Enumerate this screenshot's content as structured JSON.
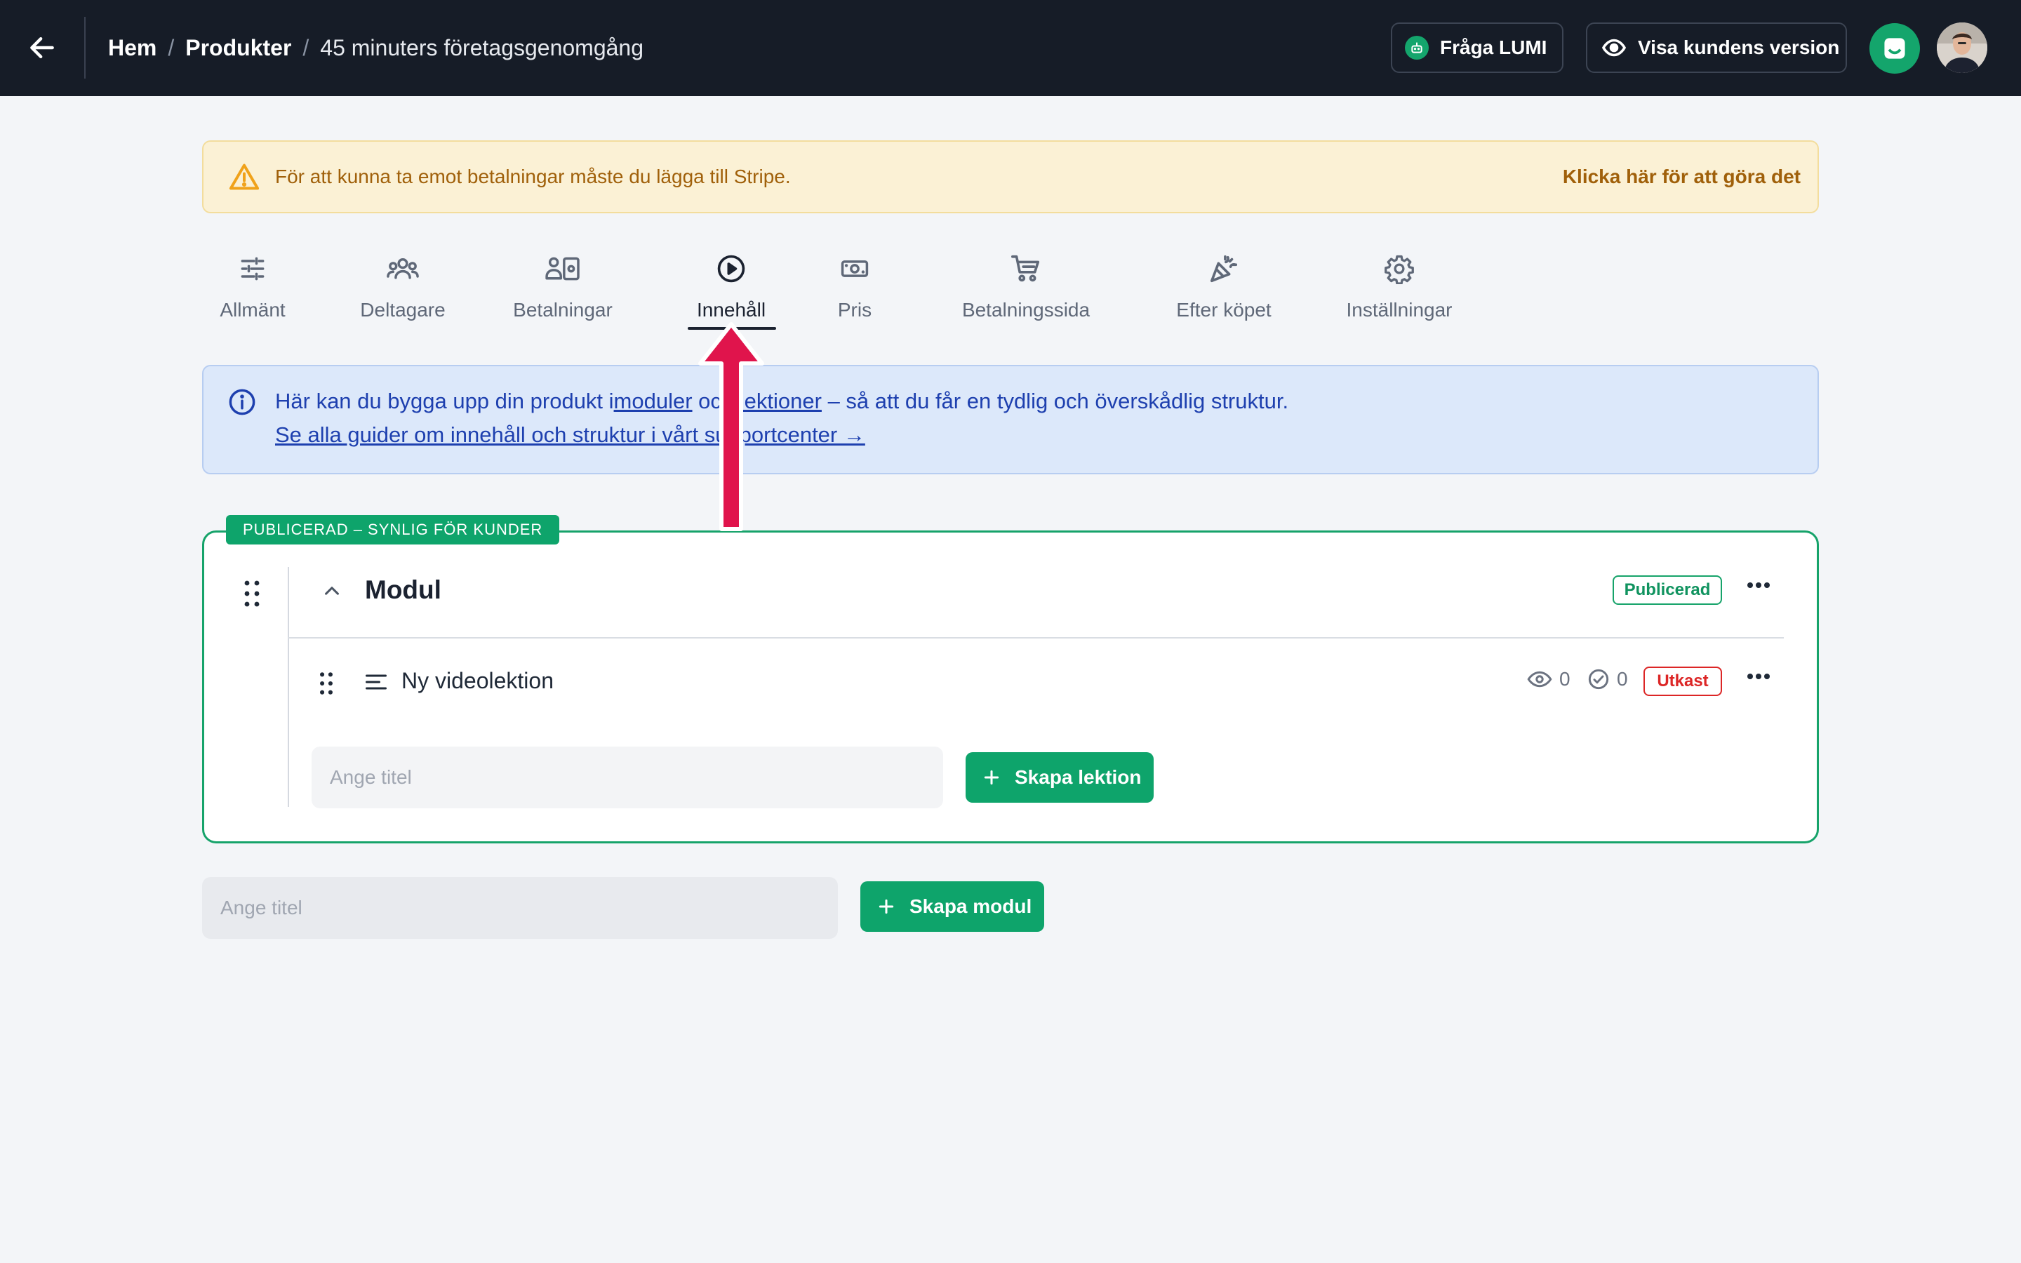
{
  "topbar": {
    "back_icon": "arrow-left-icon",
    "breadcrumb": {
      "home": "Hem",
      "separator": "/",
      "products": "Produkter",
      "current": "45 minuters företagsgenomgång"
    },
    "ask_lumi_label": "Fråga LUMI",
    "customer_view_label": "Visa kundens version",
    "app_icon": "inbox-icon",
    "avatar": "user-avatar"
  },
  "alert": {
    "icon": "warning-triangle-icon",
    "text": "För att kunna ta emot betalningar måste du lägga till Stripe.",
    "link": "Klicka här för att göra det"
  },
  "tabs": [
    {
      "label": "Allmänt",
      "icon": "sliders-icon"
    },
    {
      "label": "Deltagare",
      "icon": "users-icon"
    },
    {
      "label": "Betalningar",
      "icon": "payments-icon"
    },
    {
      "label": "Innehåll",
      "icon": "play-circle-icon",
      "active": true
    },
    {
      "label": "Pris",
      "icon": "banknote-icon"
    },
    {
      "label": "Betalningssida",
      "icon": "cart-icon"
    },
    {
      "label": "Efter köpet",
      "icon": "party-popper-icon"
    },
    {
      "label": "Inställningar",
      "icon": "gear-icon"
    }
  ],
  "info": {
    "icon": "info-circle-icon",
    "line1_pre": "Här kan du bygga upp din produkt i",
    "line1_link1": "moduler",
    "line1_mid": " och ",
    "line1_link2": "lektioner",
    "line1_post": " – så att du får en tydlig och överskådlig struktur.",
    "line2": "Se alla guider om innehåll och struktur i vårt supportcenter →"
  },
  "module": {
    "status_tag": "PUBLICERAD – SYNLIG FÖR KUNDER",
    "title": "Modul",
    "badge": "Publicerad",
    "lessons": [
      {
        "title": "Ny videolektion",
        "views": "0",
        "completed": "0",
        "badge": "Utkast"
      }
    ],
    "lesson_input_placeholder": "Ange titel",
    "create_lesson_label": "Skapa lektion"
  },
  "new_module": {
    "input_placeholder": "Ange titel",
    "create_module_label": "Skapa modul"
  },
  "colors": {
    "topbar_bg": "#161c27",
    "accent_green": "#0ea46b",
    "draft_red": "#dc2626",
    "warning_bg": "#fbf1d5",
    "info_bg": "#dce8fa",
    "annotation_arrow": "#e0144c"
  }
}
